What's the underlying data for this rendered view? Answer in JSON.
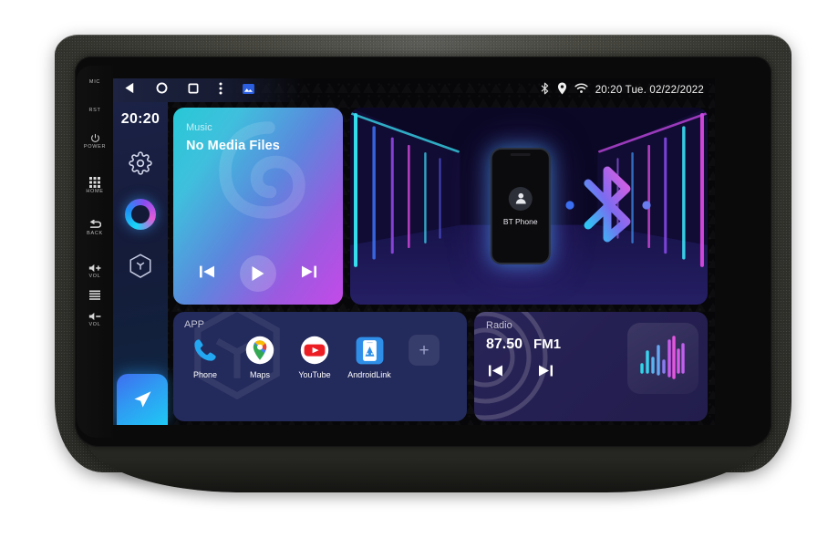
{
  "device": {
    "hardware_keys": [
      {
        "label": "MIC",
        "icon": "mic-label"
      },
      {
        "label": "RST",
        "icon": "reset-label"
      },
      {
        "label": "POWER",
        "icon": "power-icon"
      },
      {
        "label": "HOME",
        "icon": "grid-home-icon"
      },
      {
        "label": "BACK",
        "icon": "back-arrow-icon"
      },
      {
        "label": "VOL",
        "icon": "volume-up-icon"
      },
      {
        "label": "",
        "icon": "menu-lines-icon"
      },
      {
        "label": "VOL",
        "icon": "volume-down-icon"
      }
    ]
  },
  "statusbar": {
    "nav": [
      {
        "name": "back-icon"
      },
      {
        "name": "home-icon"
      },
      {
        "name": "recents-icon"
      },
      {
        "name": "overflow-menu-icon"
      },
      {
        "name": "screenshot-icon"
      }
    ],
    "icons": [
      {
        "name": "bluetooth-icon"
      },
      {
        "name": "location-pin-icon"
      },
      {
        "name": "wifi-icon"
      }
    ],
    "time": "20:20",
    "day": "Tue.",
    "date": "02/22/2022",
    "datetime_text": "20:20  Tue.  02/22/2022"
  },
  "sidebar": {
    "time": "20:20",
    "items": [
      {
        "name": "settings-gear-icon",
        "label": "Settings"
      },
      {
        "name": "voice-assistant-ring",
        "label": "Voice Assistant"
      },
      {
        "name": "apps-cube-icon",
        "label": "Apps"
      },
      {
        "name": "navigation-arrow-button",
        "label": "Navigation"
      }
    ]
  },
  "music_card": {
    "label": "Music",
    "title": "No Media Files",
    "controls": [
      {
        "name": "previous-track-button",
        "glyph": "prev"
      },
      {
        "name": "play-button",
        "glyph": "play"
      },
      {
        "name": "next-track-button",
        "glyph": "next"
      }
    ],
    "gradient_from": "#27c8d6",
    "gradient_to": "#c44ae8"
  },
  "bt_card": {
    "phone_label": "BT Phone",
    "icons": [
      "person-avatar-icon",
      "bluetooth-logo"
    ],
    "accent_cyan": "#21d6f5",
    "accent_magenta": "#e45ce0"
  },
  "app_card": {
    "label": "APP",
    "apps": [
      {
        "name": "Phone",
        "icon": "phone-handset-icon"
      },
      {
        "name": "Maps",
        "icon": "google-maps-pin-icon"
      },
      {
        "name": "YouTube",
        "icon": "youtube-icon"
      },
      {
        "name": "AndroidLink",
        "icon": "androidlink-icon"
      },
      {
        "name": "",
        "icon": "add-app-button",
        "glyph": "+"
      }
    ]
  },
  "radio_card": {
    "label": "Radio",
    "frequency": "87.50",
    "band": "FM1",
    "controls": [
      {
        "name": "radio-seek-down-button",
        "glyph": "prev"
      },
      {
        "name": "radio-seek-up-button",
        "glyph": "next"
      }
    ],
    "visualizer": {
      "name": "equalizer-icon",
      "bars": [
        14,
        30,
        20,
        40,
        16,
        46,
        58,
        34,
        50,
        26
      ]
    }
  }
}
